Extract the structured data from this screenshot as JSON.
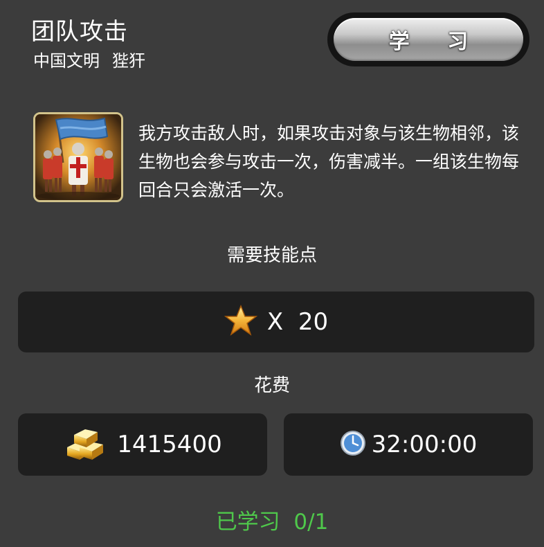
{
  "header": {
    "title": "团队攻击",
    "civilization": "中国文明",
    "unit": "狴犴"
  },
  "learn_button": {
    "label": "学 习"
  },
  "skill": {
    "icon": "crusader-squad-banner-icon",
    "description": "我方攻击敌人时，如果攻击对象与该生物相邻，该生物也会参与攻击一次，伤害减半。一组该生物每回合只会激活一次。"
  },
  "requirements": {
    "label": "需要技能点",
    "points_icon": "star-icon",
    "points_text": "X  20"
  },
  "cost": {
    "label": "花费",
    "gold_icon": "gold-bars-icon",
    "gold": "1415400",
    "time_icon": "clock-icon",
    "time": "32:00:00"
  },
  "progress": {
    "text": "已学习  0/1",
    "learned": 0,
    "max": 1,
    "color": "#4fc84b"
  },
  "colors": {
    "background": "#3c3c3c",
    "panel": "#1f1f1f",
    "icon_border": "#d2c38b"
  }
}
